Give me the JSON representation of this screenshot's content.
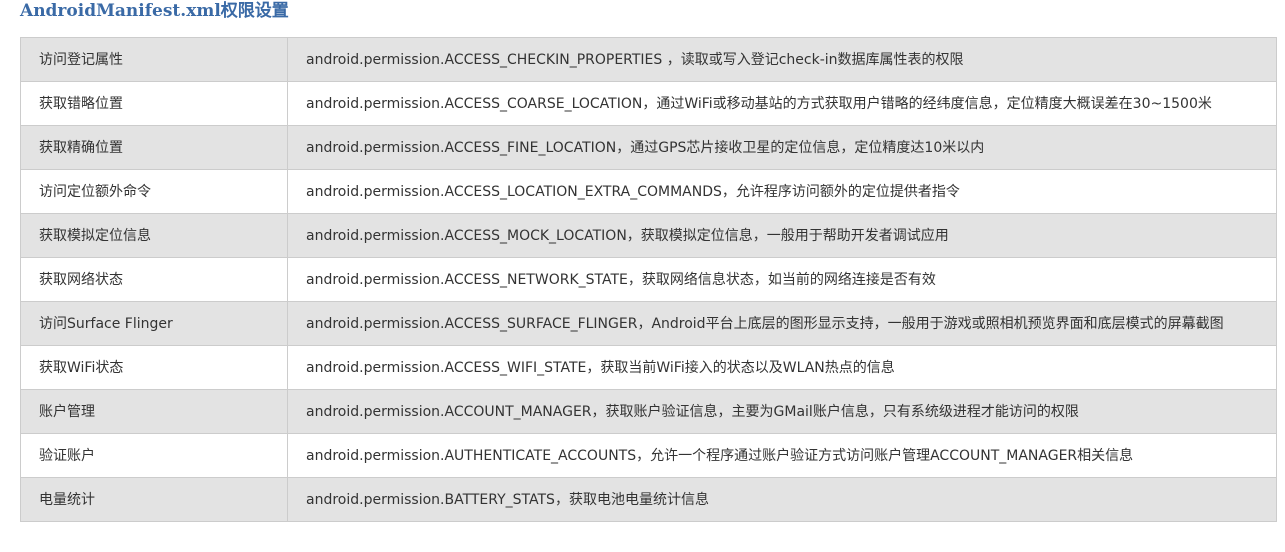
{
  "title": "AndroidManifest.xml权限设置",
  "rows": [
    {
      "name": "访问登记属性",
      "desc": "android.permission.ACCESS_CHECKIN_PROPERTIES ，读取或写入登记check-in数据库属性表的权限"
    },
    {
      "name": "获取错略位置",
      "desc": "android.permission.ACCESS_COARSE_LOCATION，通过WiFi或移动基站的方式获取用户错略的经纬度信息，定位精度大概误差在30~1500米"
    },
    {
      "name": "获取精确位置",
      "desc": "android.permission.ACCESS_FINE_LOCATION，通过GPS芯片接收卫星的定位信息，定位精度达10米以内"
    },
    {
      "name": "访问定位额外命令",
      "desc": "android.permission.ACCESS_LOCATION_EXTRA_COMMANDS，允许程序访问额外的定位提供者指令"
    },
    {
      "name": "获取模拟定位信息",
      "desc": "android.permission.ACCESS_MOCK_LOCATION，获取模拟定位信息，一般用于帮助开发者调试应用"
    },
    {
      "name": "获取网络状态",
      "desc": "android.permission.ACCESS_NETWORK_STATE，获取网络信息状态，如当前的网络连接是否有效"
    },
    {
      "name": "访问Surface Flinger",
      "desc": "android.permission.ACCESS_SURFACE_FLINGER，Android平台上底层的图形显示支持，一般用于游戏或照相机预览界面和底层模式的屏幕截图"
    },
    {
      "name": "获取WiFi状态",
      "desc": "android.permission.ACCESS_WIFI_STATE，获取当前WiFi接入的状态以及WLAN热点的信息"
    },
    {
      "name": "账户管理",
      "desc": "android.permission.ACCOUNT_MANAGER，获取账户验证信息，主要为GMail账户信息，只有系统级进程才能访问的权限"
    },
    {
      "name": "验证账户",
      "desc": "android.permission.AUTHENTICATE_ACCOUNTS，允许一个程序通过账户验证方式访问账户管理ACCOUNT_MANAGER相关信息"
    },
    {
      "name": "电量统计",
      "desc": "android.permission.BATTERY_STATS，获取电池电量统计信息"
    }
  ]
}
